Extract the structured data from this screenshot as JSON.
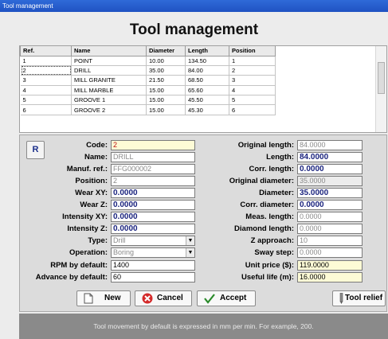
{
  "window": {
    "title": "Tool management"
  },
  "heading": "Tool management",
  "grid": {
    "columns": [
      "Ref.",
      "Name",
      "Diameter",
      "Length",
      "Position"
    ],
    "rows": [
      [
        "1",
        "POINT",
        "10.00",
        "134.50",
        "1"
      ],
      [
        "2",
        "DRILL",
        "35.00",
        "84.00",
        "2"
      ],
      [
        "3",
        "MILL GRANITE",
        "21.50",
        "68.50",
        "3"
      ],
      [
        "4",
        "MILL MARBLE",
        "15.00",
        "65.60",
        "4"
      ],
      [
        "5",
        "GROOVE 1",
        "15.00",
        "45.50",
        "5"
      ],
      [
        "6",
        "GROOVE 2",
        "15.00",
        "45.30",
        "6"
      ]
    ],
    "selected_row": 1
  },
  "r_button": "R",
  "left": {
    "code": {
      "label": "Code:",
      "value": "2"
    },
    "name": {
      "label": "Name:",
      "value": "DRILL"
    },
    "manuf_ref": {
      "label": "Manuf. ref.:",
      "value": "FFG000002"
    },
    "position": {
      "label": "Position:",
      "value": "2"
    },
    "wear_xy": {
      "label": "Wear XY:",
      "value": "0.0000"
    },
    "wear_z": {
      "label": "Wear Z:",
      "value": "0.0000"
    },
    "intensity_xy": {
      "label": "Intensity XY:",
      "value": "0.0000"
    },
    "intensity_z": {
      "label": "Intensity Z:",
      "value": "0.0000"
    },
    "type": {
      "label": "Type:",
      "value": "Drill"
    },
    "operation": {
      "label": "Operation:",
      "value": "Boring"
    },
    "rpm": {
      "label": "RPM by default:",
      "value": "1400"
    },
    "advance": {
      "label": "Advance by default:",
      "value": "60"
    }
  },
  "right": {
    "original_length": {
      "label": "Original length:",
      "value": "84.0000"
    },
    "length": {
      "label": "Length:",
      "value": "84.0000"
    },
    "corr_length": {
      "label": "Corr. length:",
      "value": "0.0000"
    },
    "original_diameter": {
      "label": "Original diameter:",
      "value": "35.0000"
    },
    "diameter": {
      "label": "Diameter:",
      "value": "35.0000"
    },
    "corr_diameter": {
      "label": "Corr. diameter:",
      "value": "0.0000"
    },
    "meas_length": {
      "label": "Meas. length:",
      "value": "0.0000"
    },
    "diamond_length": {
      "label": "Diamond length:",
      "value": "0.0000"
    },
    "z_approach": {
      "label": "Z approach:",
      "value": "10"
    },
    "sway_step": {
      "label": "Sway step:",
      "value": "0.0000"
    },
    "unit_price": {
      "label": "Unit price ($):",
      "value": "119.0000"
    },
    "useful_life": {
      "label": "Useful life (m):",
      "value": "16.0000"
    }
  },
  "buttons": {
    "new": "New",
    "cancel": "Cancel",
    "accept": "Accept",
    "tool_relief": "Tool relief"
  },
  "footer": "Tool movement by default is expressed in mm per min. For example, 200.",
  "colors": {
    "titlebar": "#2f6ad8",
    "value_blue": "#1a237e",
    "code_red": "#c01010",
    "yellow_field": "#fdfbd6",
    "footer_bg": "#8a8a8a"
  }
}
